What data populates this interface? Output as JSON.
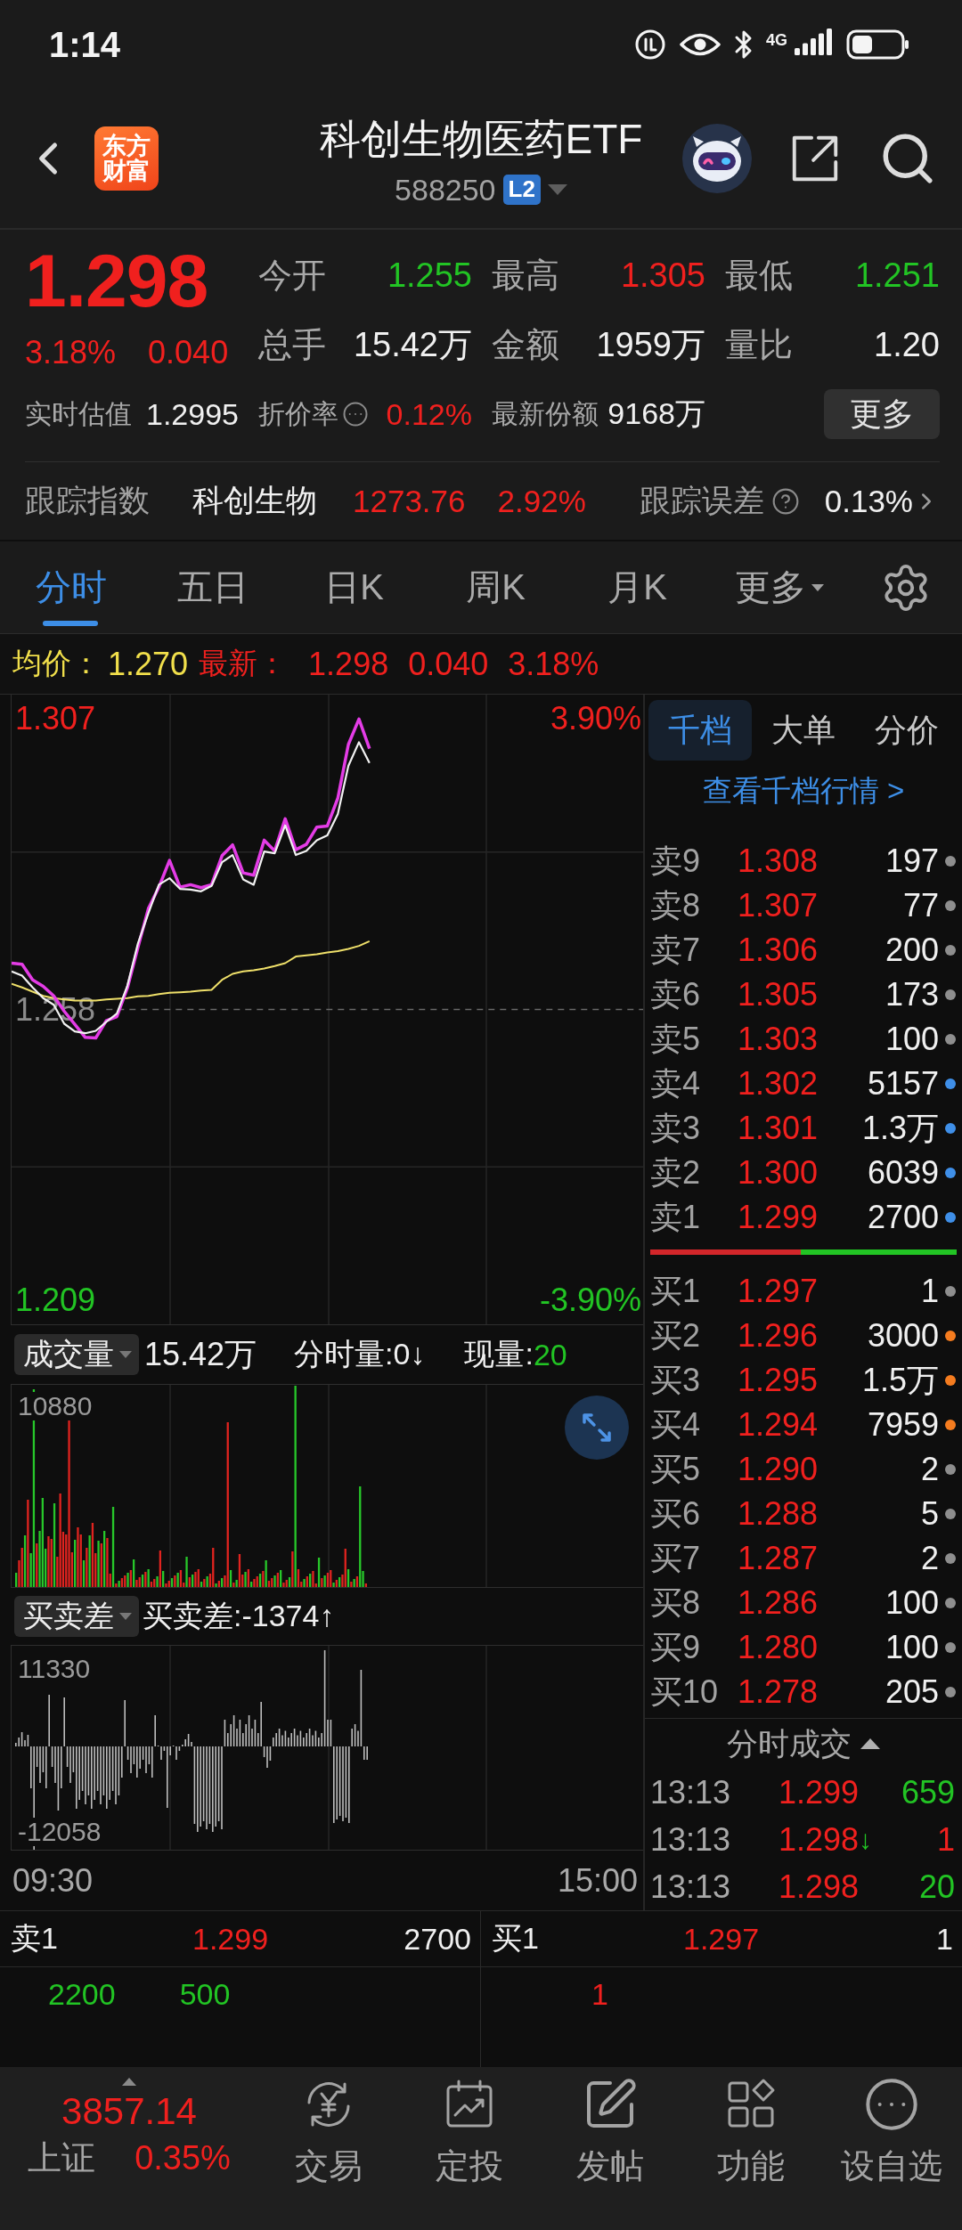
{
  "status_bar": {
    "time": "1:14",
    "network": "4G"
  },
  "header": {
    "logo": "东方财富",
    "title": "科创生物医药ETF",
    "code": "588250",
    "badge": "L2"
  },
  "quote": {
    "price": "1.298",
    "change_pct": "3.18%",
    "change": "0.040",
    "color": "#f0201e",
    "stats": [
      {
        "label": "今开",
        "value": "1.255",
        "color": "#22c424"
      },
      {
        "label": "最高",
        "value": "1.305",
        "color": "#f0201e"
      },
      {
        "label": "最低",
        "value": "1.251",
        "color": "#22c424"
      },
      {
        "label": "总手",
        "value": "15.42万",
        "color": "#f0f0f0"
      },
      {
        "label": "金额",
        "value": "1959万",
        "color": "#f0f0f0"
      },
      {
        "label": "量比",
        "value": "1.20",
        "color": "#f0f0f0"
      }
    ],
    "details": [
      {
        "label": "实时估值",
        "value": "1.2995",
        "color": "#f0f0f0",
        "info": false
      },
      {
        "label": "折价率",
        "value": "0.12%",
        "color": "#f0201e",
        "info": true
      },
      {
        "label": "最新份额",
        "value": "9168万",
        "color": "#f0f0f0",
        "info": false
      }
    ],
    "more_button": "更多"
  },
  "tracking": {
    "label": "跟踪指数",
    "index": "科创生物",
    "value": "1273.76",
    "change": "2.92%",
    "color": "#f0201e",
    "error_label": "跟踪误差",
    "error": "0.13%"
  },
  "tabs": [
    {
      "label": "分时",
      "selected": true,
      "menu": false
    },
    {
      "label": "五日",
      "selected": false,
      "menu": false
    },
    {
      "label": "日K",
      "selected": false,
      "menu": false
    },
    {
      "label": "周K",
      "selected": false,
      "menu": false
    },
    {
      "label": "月K",
      "selected": false,
      "menu": false
    },
    {
      "label": "更多",
      "selected": false,
      "menu": true
    }
  ],
  "price_info": {
    "avg_label": "均价：",
    "avg": "1.270",
    "latest_label": "最新：",
    "latest": "1.298",
    "change": "0.040",
    "change_pct": "3.18%"
  },
  "price_chart": {
    "high_pct": "3.90%",
    "low_pct": "-3.90%",
    "chart_data": {
      "type": "line",
      "categories": [
        null,
        null,
        null,
        null,
        null,
        null,
        null,
        null,
        null,
        null,
        null,
        null,
        null,
        null,
        null,
        null,
        null,
        null,
        null,
        null,
        null,
        null,
        null,
        null,
        null,
        null,
        null,
        null,
        null,
        null,
        null,
        null,
        null,
        null,
        null,
        null,
        null,
        null,
        null,
        null,
        null,
        null,
        null,
        null,
        null,
        null,
        null,
        null,
        null,
        null,
        null,
        null,
        null,
        null,
        null,
        null,
        null,
        null,
        null,
        null,
        null
      ],
      "series": [
        {
          "color": "#6a6a6a",
          "line_style": "dashed",
          "values": [
            null,
            null,
            null,
            null,
            null,
            null,
            null,
            null,
            null,
            1.258,
            1.258,
            1.258,
            1.258,
            1.258,
            1.258,
            1.258,
            1.258,
            1.258,
            1.258,
            1.258,
            1.258,
            1.258,
            1.258,
            1.258,
            1.258,
            1.258,
            1.258,
            1.258,
            1.258,
            1.258,
            1.258,
            1.258,
            1.258,
            1.258,
            1.258,
            1.258,
            1.258,
            1.258,
            1.258,
            1.258,
            1.258,
            1.258,
            1.258,
            1.258,
            1.258,
            1.258,
            1.258,
            1.258,
            1.258,
            1.258,
            1.258,
            1.258,
            1.258,
            1.258,
            1.258,
            1.258,
            1.258,
            1.258,
            1.258,
            1.258,
            1.258
          ]
        },
        {
          "color": "#efe06a",
          "values": [
            1.2623,
            1.2617,
            1.261,
            1.2603,
            1.2599,
            1.2597,
            1.2595,
            1.2595,
            1.2595,
            1.2597,
            1.2598,
            1.2599,
            1.2602,
            1.2603,
            1.2606,
            1.2608,
            1.2609,
            1.261,
            1.2612,
            1.2613,
            1.263,
            1.264,
            1.2644,
            1.2646,
            1.2649,
            1.2653,
            1.2658,
            1.2669,
            1.2671,
            1.2673,
            1.2676,
            1.2678,
            1.2682,
            1.2687,
            1.2695,
            null,
            null,
            null,
            null,
            null,
            null,
            null,
            null,
            null,
            null,
            null,
            null,
            null,
            null,
            null,
            null,
            null,
            null,
            null,
            null,
            null,
            null,
            null,
            null,
            null,
            null
          ]
        },
        {
          "color": "#e43ce6",
          "values": [
            1.2658,
            1.2656,
            1.263,
            1.2619,
            1.2603,
            1.2577,
            1.2555,
            1.2533,
            1.2532,
            1.2561,
            1.2568,
            1.2616,
            1.2684,
            1.275,
            1.2786,
            1.2831,
            1.2786,
            1.279,
            1.2785,
            1.279,
            1.2839,
            1.2857,
            1.281,
            1.2806,
            1.2865,
            1.2847,
            1.2901,
            1.2849,
            1.2858,
            1.2887,
            1.2889,
            1.2936,
            1.3026,
            1.3069,
            1.3019,
            null,
            null,
            null,
            null,
            null,
            null,
            null,
            null,
            null,
            null,
            null,
            null,
            null,
            null,
            null,
            null,
            null,
            null,
            null,
            null,
            null,
            null,
            null,
            null,
            null,
            null
          ]
        },
        {
          "color": "#f2f2f2",
          "values": [
            1.2644,
            1.2637,
            1.2617,
            1.2599,
            1.2588,
            1.2556,
            1.2543,
            1.254,
            1.2544,
            1.2559,
            1.2573,
            1.262,
            1.2691,
            1.2742,
            1.279,
            1.2801,
            1.2783,
            1.2782,
            1.2779,
            1.2788,
            1.2828,
            1.284,
            1.2799,
            1.279,
            1.2846,
            1.2843,
            1.289,
            1.284,
            1.2847,
            1.2865,
            1.2873,
            1.2909,
            1.299,
            1.303,
            1.2995,
            null,
            null,
            null,
            null,
            null,
            null,
            null,
            null,
            null,
            null,
            null,
            null,
            null,
            null,
            null,
            null,
            null,
            null,
            null,
            null,
            null,
            null,
            null,
            null,
            null,
            null
          ]
        }
      ],
      "ylim": [
        1.205,
        1.311
      ],
      "yticks": [
        {
          "value": 1.307,
          "label": "1.307"
        },
        {
          "value": 1.258,
          "label": "1.258"
        },
        {
          "value": 1.209,
          "label": "1.209"
        }
      ],
      "grid": true
    }
  },
  "volume": {
    "selector": "成交量",
    "total": "15.42万",
    "interval": "分时量:0↓",
    "current_label": "现量:",
    "current": "20",
    "max": "10880"
  },
  "order_diff": {
    "selector": "买卖差",
    "reading": "买卖差:-1374↑",
    "max": "11330",
    "min": "-12058"
  },
  "time_axis": {
    "start": "09:30",
    "end": "15:00"
  },
  "book_tabs": [
    {
      "label": "千档",
      "selected": true
    },
    {
      "label": "大单",
      "selected": false
    },
    {
      "label": "分价",
      "selected": false
    }
  ],
  "book_link": "查看千档行情 >",
  "asks": [
    {
      "label": "卖9",
      "price": "1.308",
      "volume": "197",
      "color": "#8e8e8e"
    },
    {
      "label": "卖8",
      "price": "1.307",
      "volume": "77",
      "color": "#8e8e8e"
    },
    {
      "label": "卖7",
      "price": "1.306",
      "volume": "200",
      "color": "#8e8e8e"
    },
    {
      "label": "卖6",
      "price": "1.305",
      "volume": "173",
      "color": "#8e8e8e"
    },
    {
      "label": "卖5",
      "price": "1.303",
      "volume": "100",
      "color": "#8e8e8e"
    },
    {
      "label": "卖4",
      "price": "1.302",
      "volume": "5157",
      "color": "#3f8fe8"
    },
    {
      "label": "卖3",
      "price": "1.301",
      "volume": "1.3万",
      "color": "#3f8fe8"
    },
    {
      "label": "卖2",
      "price": "1.300",
      "volume": "6039",
      "color": "#3f8fe8"
    },
    {
      "label": "卖1",
      "price": "1.299",
      "volume": "2700",
      "color": "#3f8fe8"
    }
  ],
  "balance": {
    "level": 0.49
  },
  "bids": [
    {
      "label": "买1",
      "price": "1.297",
      "volume": "1",
      "color": "#8e8e8e"
    },
    {
      "label": "买2",
      "price": "1.296",
      "volume": "3000",
      "color": "#f57c1f"
    },
    {
      "label": "买3",
      "price": "1.295",
      "volume": "1.5万",
      "color": "#f57c1f"
    },
    {
      "label": "买4",
      "price": "1.294",
      "volume": "7959",
      "color": "#f57c1f"
    },
    {
      "label": "买5",
      "price": "1.290",
      "volume": "2",
      "color": "#8e8e8e"
    },
    {
      "label": "买6",
      "price": "1.288",
      "volume": "5",
      "color": "#8e8e8e"
    },
    {
      "label": "买7",
      "price": "1.287",
      "volume": "2",
      "color": "#8e8e8e"
    },
    {
      "label": "买8",
      "price": "1.286",
      "volume": "100",
      "color": "#8e8e8e"
    },
    {
      "label": "买9",
      "price": "1.280",
      "volume": "100",
      "color": "#8e8e8e"
    },
    {
      "label": "买10",
      "price": "1.278",
      "volume": "205",
      "color": "#8e8e8e"
    }
  ],
  "trades_title": "分时成交",
  "trades": [
    {
      "time": "13:13",
      "price": "1.299",
      "volume": "659",
      "color": "#22c424"
    },
    {
      "time": "13:13",
      "price": "1.298",
      "flag": "↓",
      "volume": "1",
      "color": "#f0201e"
    },
    {
      "time": "13:13",
      "price": "1.298",
      "volume": "20",
      "color": "#22c424"
    }
  ],
  "best": {
    "ask": {
      "label": "卖1",
      "price": "1.299",
      "volume": "2700",
      "queue": [
        "2200",
        "500"
      ],
      "color": "#22c424"
    },
    "bid": {
      "label": "买1",
      "price": "1.297",
      "volume": "1",
      "queue": [
        "1"
      ],
      "color": "#f0201e"
    }
  },
  "bottom_nav": {
    "index": {
      "value": "3857.14",
      "name": "上证",
      "change": "0.35%",
      "color": "#f0201e"
    },
    "items": [
      {
        "label": "交易",
        "kind": "trade"
      },
      {
        "label": "定投",
        "kind": "plan"
      },
      {
        "label": "发帖",
        "kind": "post"
      },
      {
        "label": "功能",
        "kind": "apps"
      },
      {
        "label": "设自选",
        "kind": "more"
      }
    ]
  }
}
